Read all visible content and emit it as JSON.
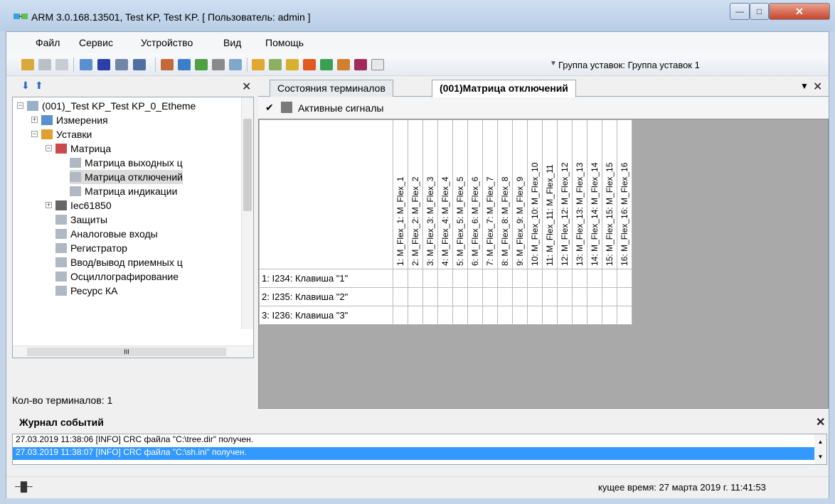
{
  "window": {
    "title": "ARM 3.0.168.13501, Test KP, Test KP. [ Пользователь: admin ]"
  },
  "menu": [
    "Файл",
    "Сервис",
    "Устройство",
    "Вид",
    "Помощь"
  ],
  "toolbar": {
    "group_label": "Группа уставок: Группа уставок 1"
  },
  "tree": {
    "items": [
      {
        "label": "(001)_Test KP_Test KP_0_Etheme",
        "level": 0,
        "icon": "computer-icon"
      },
      {
        "label": "Измерения",
        "level": 1,
        "icon": "chart-icon"
      },
      {
        "label": "Уставки",
        "level": 1,
        "icon": "box-icon"
      },
      {
        "label": "Матрица",
        "level": 2,
        "icon": "matrix-icon"
      },
      {
        "label": "Матрица выходных ц",
        "level": 3,
        "icon": "table-icon"
      },
      {
        "label": "Матрица отключений",
        "level": 3,
        "icon": "table-icon",
        "selected": true
      },
      {
        "label": "Матрица индикации",
        "level": 3,
        "icon": "table-icon"
      },
      {
        "label": "Iec61850",
        "level": 2,
        "icon": "network-icon"
      },
      {
        "label": "Защиты",
        "level": 2,
        "icon": "table-icon"
      },
      {
        "label": "Аналоговые входы",
        "level": 2,
        "icon": "table-icon"
      },
      {
        "label": "Регистратор",
        "level": 2,
        "icon": "table-icon"
      },
      {
        "label": "Ввод/вывод приемных ц",
        "level": 2,
        "icon": "table-icon"
      },
      {
        "label": "Осциллографирование",
        "level": 2,
        "icon": "table-icon"
      },
      {
        "label": "Ресурс КА",
        "level": 2,
        "icon": "table-icon"
      }
    ],
    "scroll_ellipsis": "III"
  },
  "terminals_count": "Кол-во терминалов: 1",
  "tabs": [
    {
      "label": "Состояния терминалов",
      "active": false
    },
    {
      "label": "(001)Матрица отключений",
      "active": true
    }
  ],
  "signals_label": "Активные сигналы",
  "matrix": {
    "columns": [
      "1: M_Flex_1: M_Flex_1",
      "2: M_Flex_2: M_Flex_2",
      "3: M_Flex_3: M_Flex_3",
      "4: M_Flex_4: M_Flex_4",
      "5: M_Flex_5: M_Flex_5",
      "6: M_Flex_6: M_Flex_6",
      "7: M_Flex_7: M_Flex_7",
      "8: M_Flex_8: M_Flex_8",
      "9: M_Flex_9: M_Flex_9",
      "10: M_Flex_10: M_Flex_10",
      "11: M_Flex_11: M_Flex_11",
      "12: M_Flex_12: M_Flex_12",
      "13: M_Flex_13: M_Flex_13",
      "14: M_Flex_14: M_Flex_14",
      "15: M_Flex_15: M_Flex_15",
      "16: M_Flex_16: M_Flex_16"
    ],
    "rows": [
      "1: I234:  Клавиша \"1\"",
      "2: I235:  Клавиша \"2\"",
      "3: I236:  Клавиша \"3\""
    ]
  },
  "journal": {
    "title": "Журнал событий",
    "entries": [
      {
        "text": "27.03.2019 11:38:06 [INFO] CRC файла \"C:\\tree.dir\" получен.",
        "selected": false
      },
      {
        "text": "27.03.2019 11:38:07 [INFO] CRC файла \"C:\\sh.ini\" получен.",
        "selected": true
      }
    ]
  },
  "status": {
    "time_text": "кущее время: 27 марта 2019 г. 11:41:53"
  }
}
